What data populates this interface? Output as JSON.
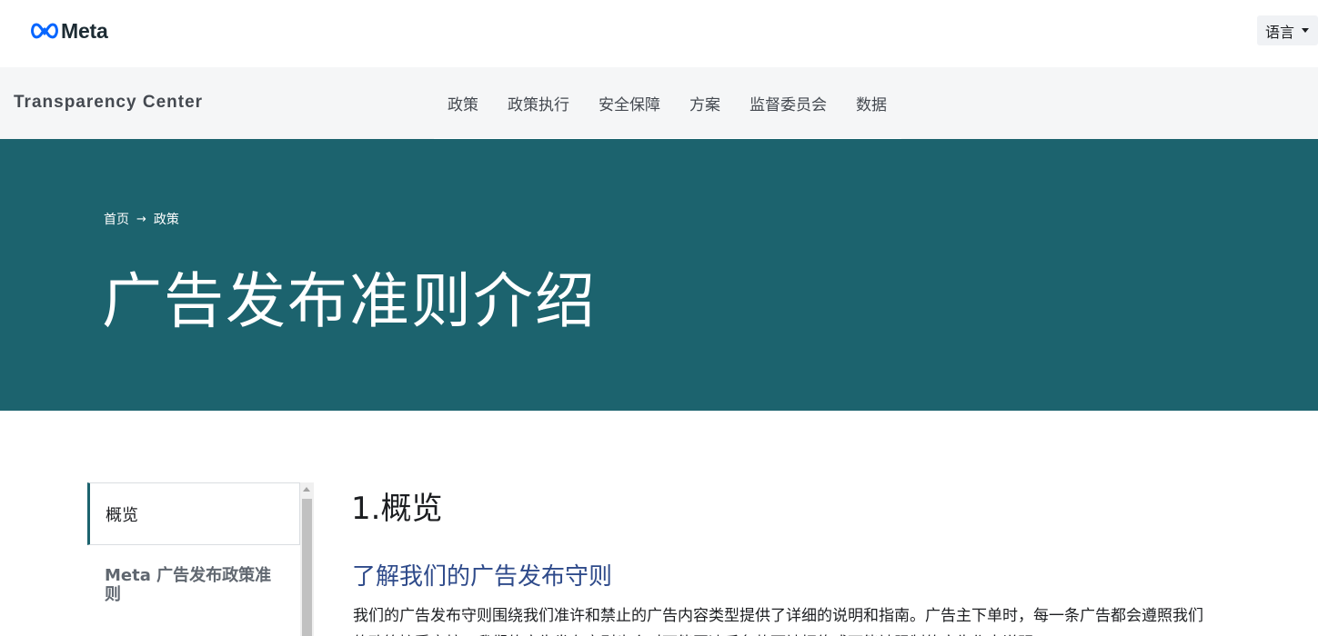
{
  "header": {
    "logo_text": "Meta",
    "language_label": "语言"
  },
  "nav": {
    "brand": "Transparency Center",
    "links": [
      "政策",
      "政策执行",
      "安全保障",
      "方案",
      "监督委员会",
      "数据"
    ]
  },
  "hero": {
    "breadcrumb_home": "首页",
    "breadcrumb_arrow": "→",
    "breadcrumb_current": "政策",
    "title": "广告发布准则介绍"
  },
  "sidebar": {
    "items": [
      {
        "label": "概览"
      },
      {
        "label": "Meta 广告发布政策准则"
      }
    ]
  },
  "content": {
    "section_title": "1.概览",
    "subtitle": "了解我们的广告发布守则",
    "paragraph": "我们的广告发布守则围绕我们准许和禁止的广告内容类型提供了详细的说明和指南。广告主下单时，每一条广告都会遵照我们的政策接受审核。我们的广告发布守则也会对可能因违反条款而被拒绝或可能被限制的广告作出说明。"
  },
  "colors": {
    "hero_bg": "#1c636e",
    "nav_bg": "#f5f6f7",
    "accent": "#1c636e",
    "subtitle": "#2e4a8a"
  }
}
